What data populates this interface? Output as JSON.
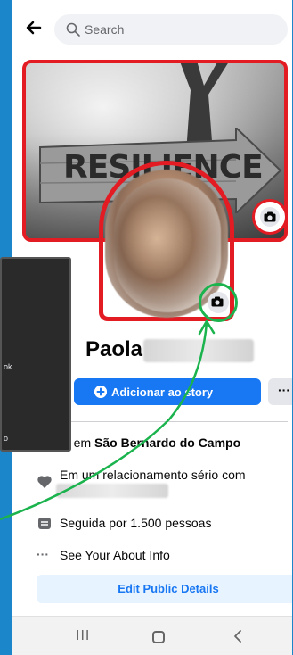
{
  "search": {
    "placeholder": "Search"
  },
  "cover": {
    "sign_text": "RESILIENCE"
  },
  "tooltip": {
    "line1": "ok",
    "line2": "o"
  },
  "profile": {
    "first_name": "Paola"
  },
  "actions": {
    "add_story": "Adicionar ao story",
    "more": "···"
  },
  "details": {
    "lives_prefix": "a em",
    "lives_city": "São Bernardo do Campo",
    "relationship": "Em um relacionamento sério com",
    "followers": "Seguida por 1.500 pessoas",
    "about": "See Your About Info",
    "about_icon": "···"
  },
  "edit": {
    "label": "Edit Public Details"
  },
  "navbar": {
    "recent": "III"
  },
  "colors": {
    "highlight_red": "#e31b23",
    "highlight_green": "#1bb34d",
    "brand_blue": "#1877f2",
    "background": "#1b86c9"
  }
}
